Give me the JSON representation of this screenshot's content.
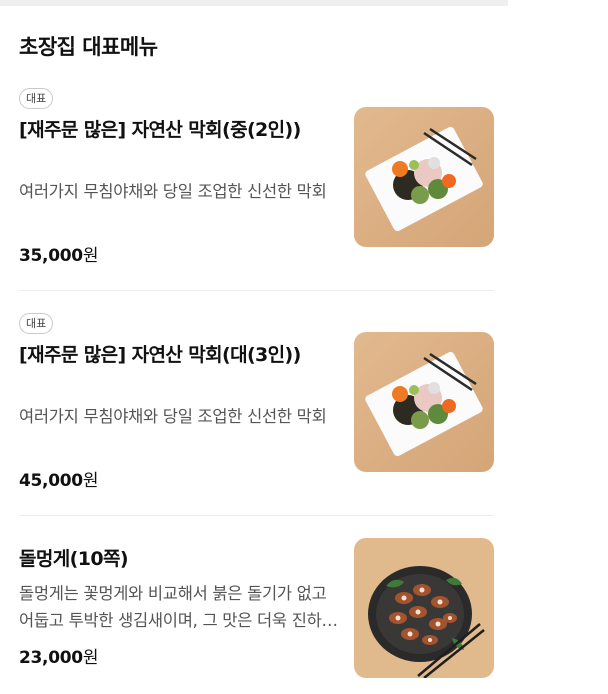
{
  "section": {
    "title": "초장집 대표메뉴"
  },
  "items": [
    {
      "badge": "대표",
      "name": "[재주문 많은] 자연산 막회(중(2인))",
      "description": "여러가지 무침야채와 당일 조업한 신선한 막회",
      "price": "35,000",
      "currency": "원",
      "image": "sashimi-platter-photo"
    },
    {
      "badge": "대표",
      "name": "[재주문 많은] 자연산 막회(대(3인))",
      "description": "여러가지 무침야채와 당일 조업한 신선한 막회",
      "price": "45,000",
      "currency": "원",
      "image": "sashimi-platter-photo"
    },
    {
      "badge": "",
      "name": "돌멍게(10쪽)",
      "description": "돌멍게는 꽃멍게와 비교해서 붉은 돌기가 없고 어둡고 투박한 생김새이며, 그 맛은 더욱 진하고 독특합니다.",
      "price": "23,000",
      "currency": "원",
      "image": "sea-squirt-plate-photo"
    }
  ]
}
